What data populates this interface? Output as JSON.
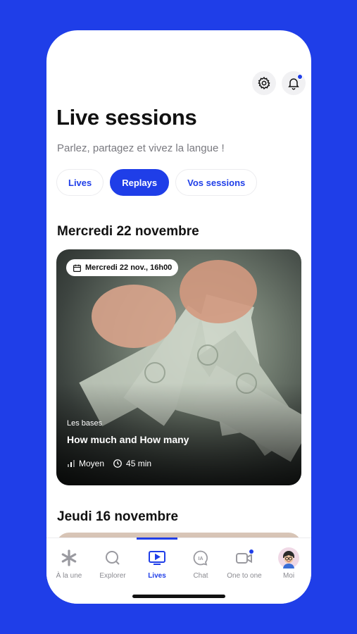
{
  "header": {
    "title": "Live sessions",
    "subtitle": "Parlez, partagez et vivez la langue !"
  },
  "icons": {
    "settings": "gear-icon",
    "notifications": "bell-icon",
    "notification_dot_color": "#1f3ee8"
  },
  "tabs": [
    {
      "label": "Lives",
      "active": false
    },
    {
      "label": "Replays",
      "active": true
    },
    {
      "label": "Vos sessions",
      "active": false
    }
  ],
  "sections": [
    {
      "heading": "Mercredi 22 novembre",
      "card": {
        "date_badge": "Mercredi 22 nov., 16h00",
        "category": "Les bases",
        "title": "How much and How many",
        "level": "Moyen",
        "duration": "45 min"
      }
    },
    {
      "heading": "Jeudi 16 novembre"
    }
  ],
  "bottom_nav": [
    {
      "label": "À la une",
      "icon": "asterisk-icon"
    },
    {
      "label": "Explorer",
      "icon": "search-icon"
    },
    {
      "label": "Lives",
      "icon": "play-screen-icon",
      "active": true
    },
    {
      "label": "Chat",
      "icon": "ia-chat-icon"
    },
    {
      "label": "One to one",
      "icon": "video-camera-icon"
    },
    {
      "label": "Moi",
      "icon": "avatar-icon"
    }
  ],
  "colors": {
    "accent": "#1f3ee8",
    "background": "#1f3ee8"
  }
}
